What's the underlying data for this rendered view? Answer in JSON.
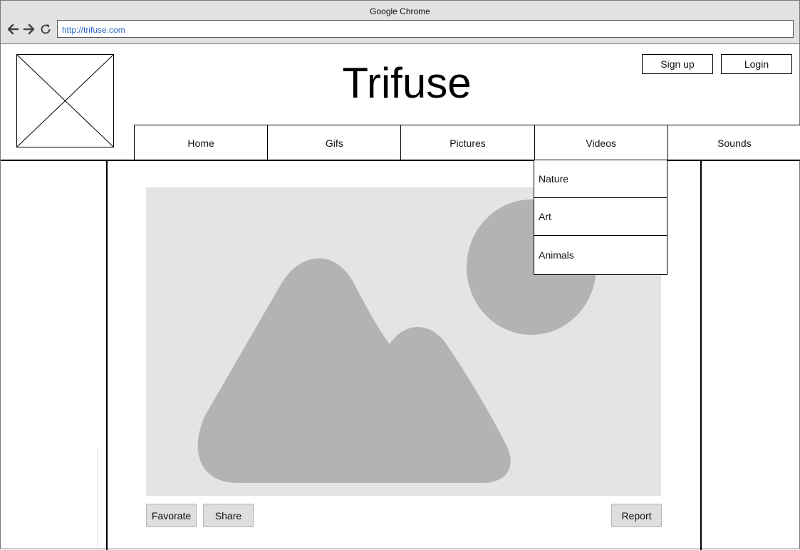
{
  "browser": {
    "window_title": "Google Chrome",
    "url": "http://trifuse.com",
    "back_icon": "arrow-left-icon",
    "forward_icon": "arrow-right-icon",
    "reload_icon": "reload-icon"
  },
  "site": {
    "title": "Trifuse",
    "logo_icon": "image-placeholder-icon"
  },
  "auth": {
    "signup_label": "Sign up",
    "login_label": "Login"
  },
  "nav": {
    "items": [
      {
        "label": "Home"
      },
      {
        "label": "Gifs"
      },
      {
        "label": "Pictures"
      },
      {
        "label": "Videos"
      },
      {
        "label": "Sounds"
      }
    ]
  },
  "dropdown": {
    "items": [
      {
        "label": "Nature"
      },
      {
        "label": "Art"
      },
      {
        "label": "Animals"
      }
    ]
  },
  "content": {
    "image_icon": "image-placeholder-icon",
    "favorite_label": "Favorate",
    "share_label": "Share",
    "report_label": "Report"
  },
  "colors": {
    "chrome_bar": "#e2e2e2",
    "url_text": "#2a67c2",
    "image_bg": "#e4e4e4",
    "image_shapes": "#b3b3b3",
    "button_bg": "#dedede"
  }
}
